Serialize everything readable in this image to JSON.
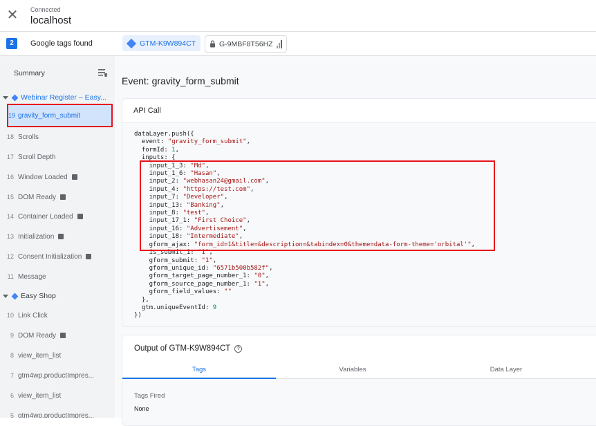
{
  "header": {
    "connected_label": "Connected",
    "host": "localhost"
  },
  "tagsbar": {
    "count": "2",
    "found_label": "Google tags found",
    "chip_gtm": "GTM-K9W894CT",
    "chip_ga": "G-9MBF8T56HZ"
  },
  "sidebar": {
    "summary_label": "Summary",
    "group1": "Webinar Register – Easy...",
    "group2": "Easy Shop",
    "items1": [
      {
        "num": "19",
        "label": "gravity_form_submit"
      },
      {
        "num": "18",
        "label": "Scrolls"
      },
      {
        "num": "17",
        "label": "Scroll Depth"
      },
      {
        "num": "16",
        "label": "Window Loaded"
      },
      {
        "num": "15",
        "label": "DOM Ready"
      },
      {
        "num": "14",
        "label": "Container Loaded"
      },
      {
        "num": "13",
        "label": "Initialization"
      },
      {
        "num": "12",
        "label": "Consent Initialization"
      },
      {
        "num": "11",
        "label": "Message"
      }
    ],
    "items2": [
      {
        "num": "10",
        "label": "Link Click"
      },
      {
        "num": "9",
        "label": "DOM Ready"
      },
      {
        "num": "8",
        "label": "view_item_list"
      },
      {
        "num": "7",
        "label": "gtm4wp.productImpres..."
      },
      {
        "num": "6",
        "label": "view_item_list"
      },
      {
        "num": "5",
        "label": "gtm4wp.productImpres..."
      }
    ]
  },
  "main": {
    "event_title": "Event: gravity_form_submit",
    "api_call_label": "API Call",
    "output_label": "Output of GTM-K9W894CT",
    "tabs": [
      "Tags",
      "Variables",
      "Data Layer"
    ],
    "tags_fired_label": "Tags Fired",
    "tags_fired_value": "None"
  },
  "code": {
    "l1": "dataLayer.push({",
    "l2k": "  event: ",
    "l2v": "\"gravity_form_submit\"",
    "l2e": ",",
    "l3k": "  formId: ",
    "l3v": "1",
    "l3e": ",",
    "l4": "  inputs: {",
    "l5k": "    input_1_3: ",
    "l5v": "\"Md\"",
    "l5e": ",",
    "l6k": "    input_1_6: ",
    "l6v": "\"Hasan\"",
    "l6e": ",",
    "l7k": "    input_2: ",
    "l7v": "\"webhasan24@gmail.com\"",
    "l7e": ",",
    "l8k": "    input_4: ",
    "l8v": "\"https://test.com\"",
    "l8e": ",",
    "l9k": "    input_7: ",
    "l9v": "\"Developer\"",
    "l9e": ",",
    "l10k": "    input_13: ",
    "l10v": "\"Banking\"",
    "l10e": ",",
    "l11k": "    input_8: ",
    "l11v": "\"test\"",
    "l11e": ",",
    "l12k": "    input_17_1: ",
    "l12v": "\"First Choice\"",
    "l12e": ",",
    "l13k": "    input_16: ",
    "l13v": "\"Advertisement\"",
    "l13e": ",",
    "l14k": "    input_18: ",
    "l14v": "\"Intermediate\"",
    "l14e": ",",
    "l15k": "    gform_ajax: ",
    "l15v": "\"form_id=1&title=&description=&tabindex=0&theme=data-form-theme='orbital'\"",
    "l15e": ",",
    "l16k": "    is_submit_1: ",
    "l16v": "\"1\"",
    "l16e": ",",
    "l17k": "    gform_submit: ",
    "l17v": "\"1\"",
    "l17e": ",",
    "l18k": "    gform_unique_id: ",
    "l18v": "\"6571b500b582f\"",
    "l18e": ",",
    "l19k": "    gform_target_page_number_1: ",
    "l19v": "\"0\"",
    "l19e": ",",
    "l20k": "    gform_source_page_number_1: ",
    "l20v": "\"1\"",
    "l20e": ",",
    "l21k": "    gform_field_values: ",
    "l21v": "\"\"",
    "l22": "  },",
    "l23k": "  gtm.uniqueEventId: ",
    "l23v": "9",
    "l24": "})"
  }
}
